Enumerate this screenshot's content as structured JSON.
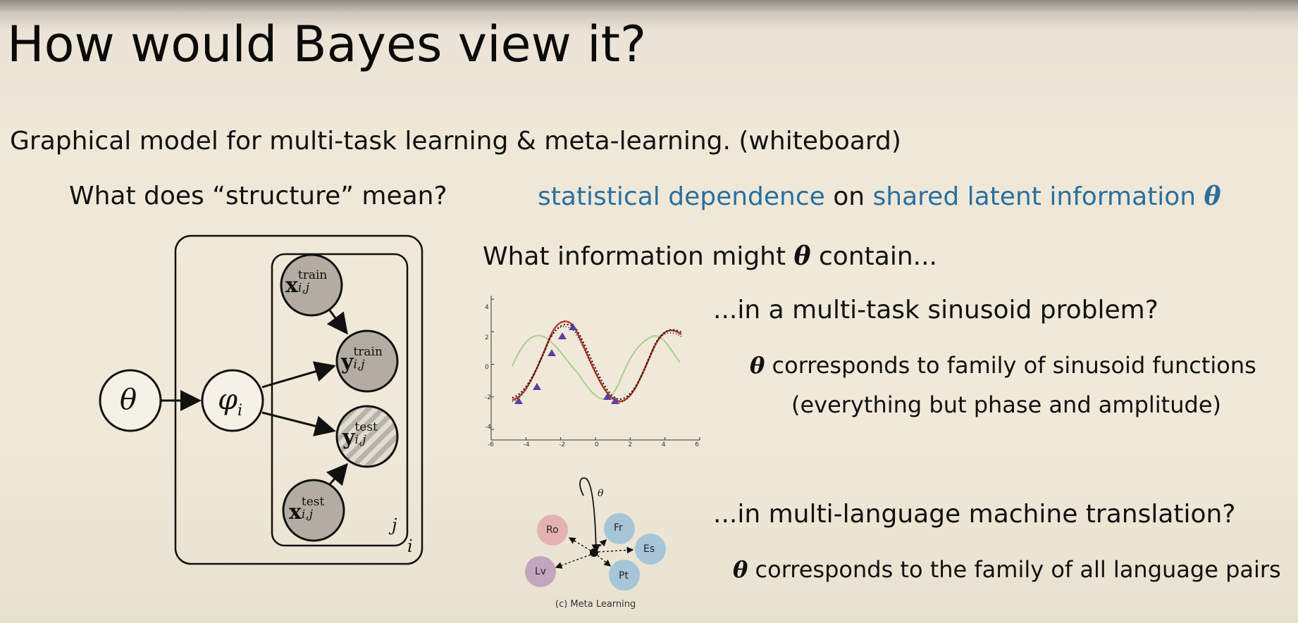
{
  "title": "How would Bayes view it?",
  "subtitle": "Graphical model for multi-task learning & meta-learning.  (whiteboard)",
  "structure_question": "What does “structure” mean?",
  "answer": {
    "part1": "statistical dependence",
    "part2": " on ",
    "part3": "shared latent information ",
    "theta": "θ"
  },
  "info_question": {
    "pre": "What information might ",
    "theta": "θ",
    "post": " contain..."
  },
  "sinusoid": {
    "question": "...in a multi-task sinusoid problem?",
    "answer_theta": "θ",
    "answer_line1": " corresponds to family of sinusoid functions",
    "answer_line2": "(everything but phase and amplitude)",
    "plot_ticks_x": [
      "-6",
      "-4",
      "-2",
      "0",
      "2",
      "4",
      "6"
    ],
    "plot_ticks_y": [
      "4",
      "2",
      "0",
      "-2",
      "-4"
    ]
  },
  "translation": {
    "question": "...in multi-language machine translation?",
    "answer_theta": "θ",
    "answer_rest": " corresponds to the family of all language pairs",
    "theta_label": "θ",
    "caption": "(c) Meta Learning",
    "languages": [
      "Ro",
      "Fr",
      "Es",
      "Pt",
      "Lv"
    ]
  },
  "graph": {
    "theta": "θ",
    "phi": "φ",
    "phi_sub": "i",
    "plate_inner": "j",
    "plate_outer": "i",
    "x_train": {
      "base": "x",
      "sup": "train",
      "sub": "i,j"
    },
    "y_train": {
      "base": "y",
      "sup": "train",
      "sub": "i,j"
    },
    "y_test": {
      "base": "y",
      "sup": "test",
      "sub": "i,j"
    },
    "x_test": {
      "base": "x",
      "sup": "test",
      "sub": "i,j"
    }
  },
  "colors": {
    "blue_text": "#2a6f9e",
    "node_gray": "#b3aca2",
    "ro": "#e4b3b1",
    "blue_node": "#a6c6d8",
    "lv": "#c2a6bd"
  }
}
